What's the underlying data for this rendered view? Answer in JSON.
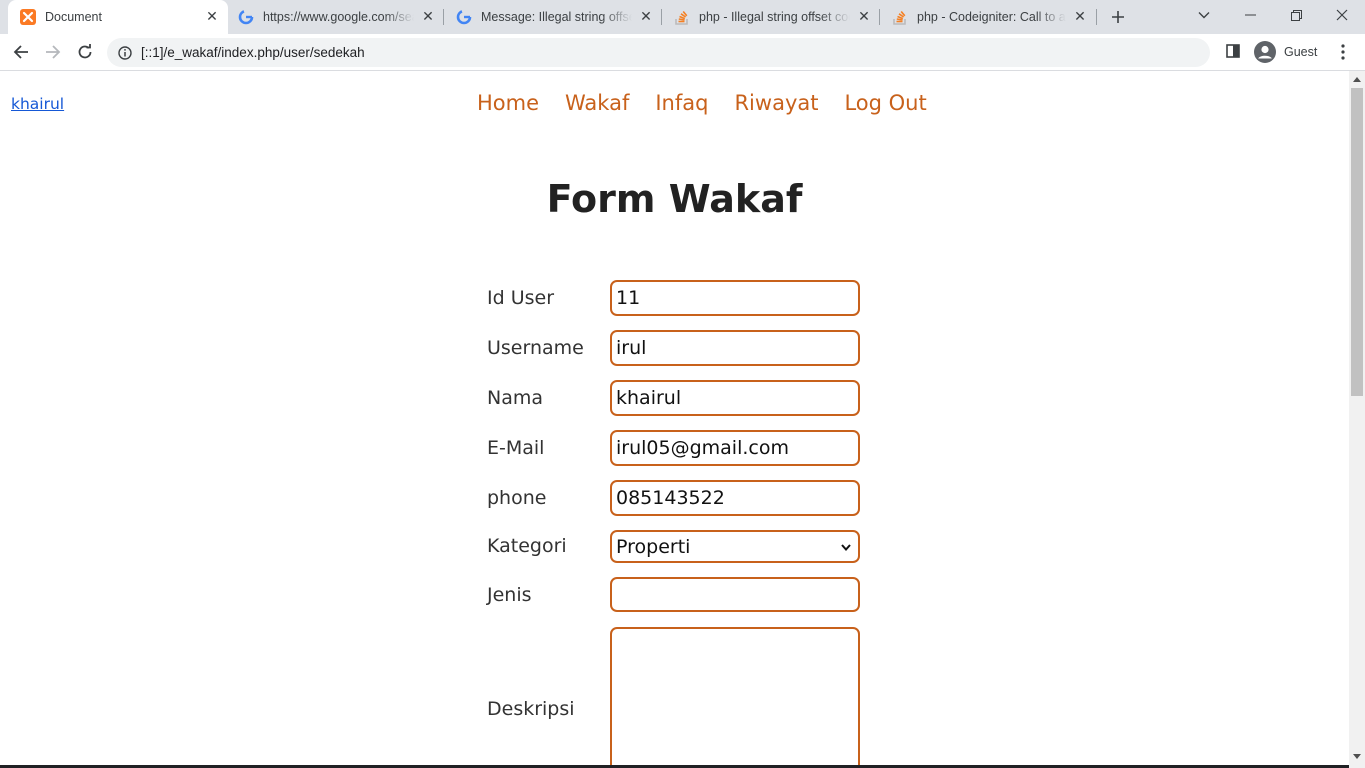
{
  "browser": {
    "tabs": [
      {
        "title": "Document",
        "active": true,
        "icon": "xampp-icon"
      },
      {
        "title": "https://www.google.com/search",
        "active": false,
        "icon": "google-icon"
      },
      {
        "title": "Message: Illegal string offset",
        "active": false,
        "icon": "google-icon"
      },
      {
        "title": "php - Illegal string offset code",
        "active": false,
        "icon": "stackoverflow-icon"
      },
      {
        "title": "php - Codeigniter: Call to a member",
        "active": false,
        "icon": "stackoverflow-icon"
      }
    ],
    "url": "[::1]/e_wakaf/index.php/user/sedekah",
    "profile_label": "Guest"
  },
  "page": {
    "user_link": "khairul",
    "nav": [
      "Home",
      "Wakaf",
      "Infaq",
      "Riwayat",
      "Log Out"
    ],
    "form_title": "Form Wakaf",
    "fields": {
      "id_user": {
        "label": "Id User",
        "value": "11"
      },
      "username": {
        "label": "Username",
        "value": "irul"
      },
      "nama": {
        "label": "Nama",
        "value": "khairul"
      },
      "email": {
        "label": "E-Mail",
        "value": "irul05@gmail.com"
      },
      "phone": {
        "label": "phone",
        "value": "085143522"
      },
      "kategori": {
        "label": "Kategori",
        "value": "Properti"
      },
      "jenis": {
        "label": "Jenis",
        "value": ""
      },
      "deskripsi": {
        "label": "Deskripsi",
        "value": ""
      }
    }
  },
  "colors": {
    "accent": "#c8611b",
    "link": "#1558d6"
  }
}
